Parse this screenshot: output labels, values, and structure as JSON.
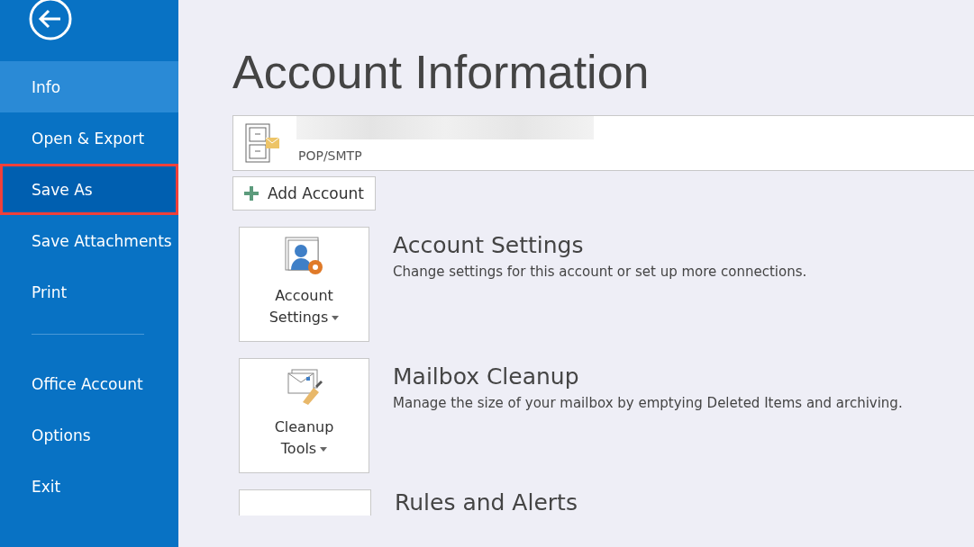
{
  "sidebar": {
    "items": [
      {
        "label": "Info",
        "selected": true,
        "highlighted": false,
        "kind": "item"
      },
      {
        "label": "Open & Export",
        "selected": false,
        "highlighted": false,
        "kind": "item"
      },
      {
        "label": "Save As",
        "selected": false,
        "highlighted": true,
        "kind": "item"
      },
      {
        "label": "Save Attachments",
        "selected": false,
        "highlighted": false,
        "kind": "item"
      },
      {
        "label": "Print",
        "selected": false,
        "highlighted": false,
        "kind": "item"
      },
      {
        "kind": "divider"
      },
      {
        "label": "Office Account",
        "selected": false,
        "highlighted": false,
        "kind": "item"
      },
      {
        "label": "Options",
        "selected": false,
        "highlighted": false,
        "kind": "item"
      },
      {
        "label": "Exit",
        "selected": false,
        "highlighted": false,
        "kind": "item"
      }
    ]
  },
  "page_title": "Account Information",
  "account": {
    "type": "POP/SMTP"
  },
  "add_account": "Add Account",
  "sections": [
    {
      "kind": "settings",
      "button": [
        "Account",
        "Settings"
      ],
      "title": "Account Settings",
      "description": "Change settings for this account or set up more connections."
    },
    {
      "kind": "cleanup",
      "button": [
        "Cleanup",
        "Tools"
      ],
      "title": "Mailbox Cleanup",
      "description": "Manage the size of your mailbox by emptying Deleted Items and archiving."
    },
    {
      "kind": "rules",
      "title": "Rules and Alerts"
    }
  ]
}
